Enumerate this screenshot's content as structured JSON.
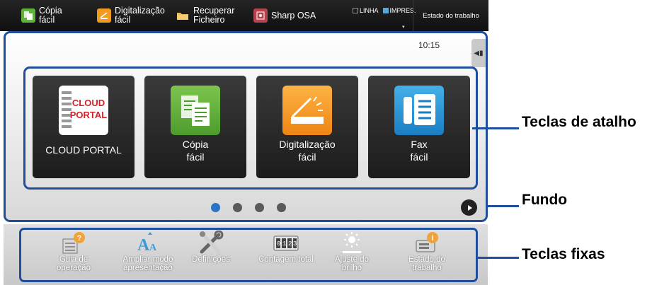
{
  "topbar": {
    "items": [
      {
        "label": "Cópia\nfácil",
        "icon": "copy-icon"
      },
      {
        "label": "Digitalização\nfácil",
        "icon": "scan-icon"
      },
      {
        "label": "Recuperar\nFicheiro",
        "icon": "folder-icon"
      },
      {
        "label": "Sharp OSA",
        "icon": "osa-icon"
      }
    ],
    "status": {
      "line": "LINHA",
      "print": "IMPRES."
    },
    "job_status": "Estado do trabalho"
  },
  "main": {
    "clock": "10:15",
    "shortcuts": [
      {
        "label": "CLOUD PORTAL",
        "icon_text": "CLOUD\nPORTAL",
        "icon": "cloud-portal-icon"
      },
      {
        "label": "Cópia\nfácil",
        "icon": "copy-icon"
      },
      {
        "label": "Digitalização\nfácil",
        "icon": "scan-icon"
      },
      {
        "label": "Fax\nfácil",
        "icon": "fax-icon"
      }
    ],
    "pages": {
      "count": 4,
      "current": 1
    }
  },
  "fixed_keys": [
    {
      "label": "Guia de\noperação",
      "icon": "help-guide-icon"
    },
    {
      "label": "Ampliar modo\napresentação",
      "icon": "zoom-text-icon"
    },
    {
      "label": "Definições",
      "icon": "settings-tools-icon"
    },
    {
      "label": "Contagem total",
      "icon": "counter-icon"
    },
    {
      "label": "Ajuste do\nbrilho",
      "icon": "brightness-icon"
    },
    {
      "label": "Estado do\ntrabalho",
      "icon": "job-status-icon"
    }
  ],
  "callouts": {
    "shortcut_keys": "Teclas de atalho",
    "background": "Fundo",
    "fixed_keys": "Teclas fixas"
  },
  "colors": {
    "frame": "#1f4e9c",
    "copy": "#5fb33b",
    "scan": "#f29a1f",
    "fax": "#1b7ec4",
    "active_dot": "#2a73c7"
  }
}
